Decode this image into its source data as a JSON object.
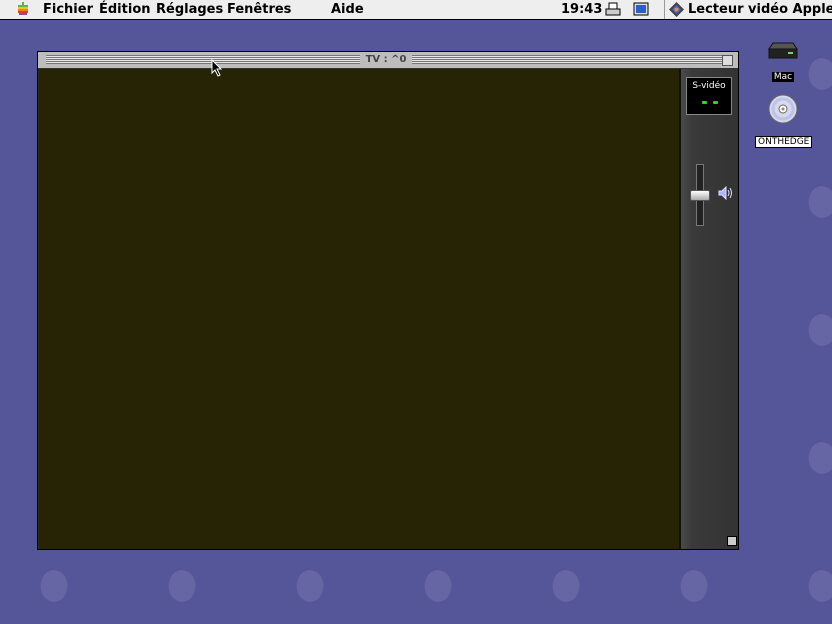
{
  "menubar": {
    "apple_icon": "apple-logo-icon",
    "items": [
      "Fichier",
      "Édition",
      "Réglages",
      "Fenêtres",
      "Aide"
    ],
    "clock": "19:43",
    "printer_icon": "printer-icon",
    "monitor_icon": "monitor-icon",
    "app_icon": "video-player-icon",
    "app_name": "Lecteur vidéo Apple"
  },
  "desktop": {
    "icons": [
      {
        "label": "Mac",
        "icon": "hard-disk-icon"
      },
      {
        "label": "ONTHEDGE",
        "icon": "cd-rom-icon"
      }
    ]
  },
  "window": {
    "title": "TV : ^0",
    "source_label": "S-vidéo",
    "volume_icon": "speaker-icon",
    "volume_level": 0.5
  },
  "colors": {
    "desktop_bg": "#55559a",
    "video_bg": "#262404",
    "panel_bg": "#333333",
    "led": "#1fe01f"
  }
}
